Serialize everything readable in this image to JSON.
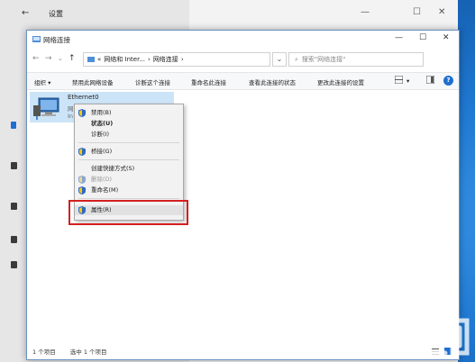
{
  "settings": {
    "title": "设置"
  },
  "explorer": {
    "title": "网络连接",
    "address": {
      "part1": "网络和 Inter...",
      "sep": "›",
      "part2": "网络连接",
      "prefix": "«"
    },
    "search_placeholder": "搜索\"网络连接\"",
    "commands": [
      "组织 ▾",
      "禁用此网络设备",
      "诊断这个连接",
      "重命名此连接",
      "查看此连接的状态",
      "更改此连接的设置"
    ],
    "item": {
      "name": "Ethernet0",
      "ghost1": "网",
      "ghost2": "In"
    },
    "status": {
      "count": "1 个项目",
      "selected": "选中 1 个项目"
    }
  },
  "context_menu": {
    "items": {
      "disable": "禁用(B)",
      "status": "状态(U)",
      "diagnose": "诊断(I)",
      "bridge": "桥接(G)",
      "shortcut": "创建快捷方式(S)",
      "delete": "删除(D)",
      "rename": "重命名(M)",
      "properties": "属性(R)"
    }
  },
  "colors": {
    "accent": "#1e6fd0",
    "highlight_box": "#d41f1f",
    "selection": "#cce4f7"
  }
}
